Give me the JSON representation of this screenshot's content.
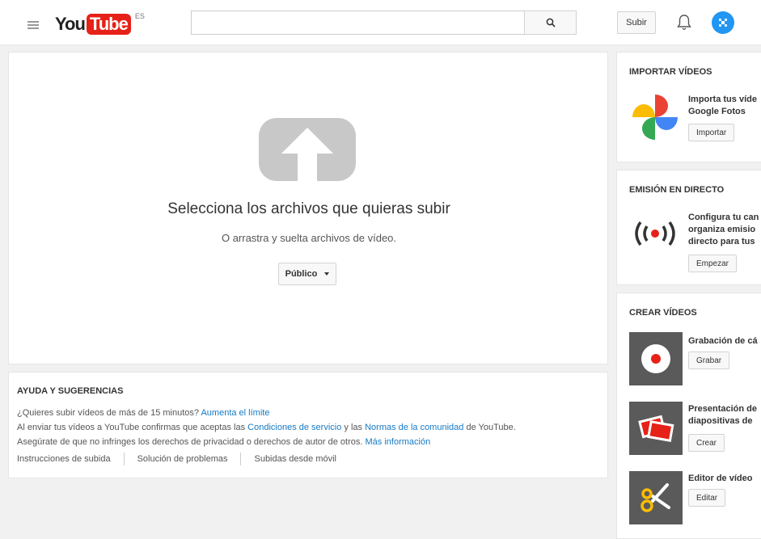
{
  "header": {
    "logo_you": "You",
    "logo_tube": "Tube",
    "logo_region": "ES",
    "search_placeholder": "",
    "upload_label": "Subir"
  },
  "upload": {
    "title": "Selecciona los archivos que quieras subir",
    "subtitle": "O arrastra y suelta archivos de vídeo.",
    "privacy_value": "Público"
  },
  "help": {
    "title": "AYUDA Y SUGERENCIAS",
    "line1_text": "¿Quieres subir vídeos de más de 15 minutos?",
    "line1_link": "Aumenta el límite",
    "line2_a": "Al enviar tus vídeos a YouTube confirmas que aceptas las",
    "line2_link1": "Condiciones de servicio",
    "line2_b": "y las",
    "line2_link2": "Normas de la comunidad",
    "line2_c": "de YouTube.",
    "line3_text": "Asegúrate de que no infringes los derechos de privacidad o derechos de autor de otros.",
    "line3_link": "Más información",
    "links": [
      "Instrucciones de subida",
      "Solución de problemas",
      "Subidas desde móvil"
    ]
  },
  "sidebar": {
    "import": {
      "title": "IMPORTAR VÍDEOS",
      "text1": "Importa tus víde",
      "text2": "Google Fotos",
      "button": "Importar"
    },
    "live": {
      "title": "EMISIÓN EN DIRECTO",
      "text1": "Configura tu can",
      "text2": "organiza emisio",
      "text3": "directo para tus",
      "button": "Empezar"
    },
    "create": {
      "title": "CREAR VÍDEOS",
      "items": [
        {
          "label": "Grabación de cá",
          "button": "Grabar"
        },
        {
          "label": "Presentación de",
          "label2": "diapositivas de",
          "button": "Crear"
        },
        {
          "label": "Editor de vídeo",
          "button": "Editar"
        }
      ]
    }
  },
  "colors": {
    "brand_red": "#e62117",
    "link_blue": "#167ac6",
    "avatar_blue": "#2196f3"
  }
}
